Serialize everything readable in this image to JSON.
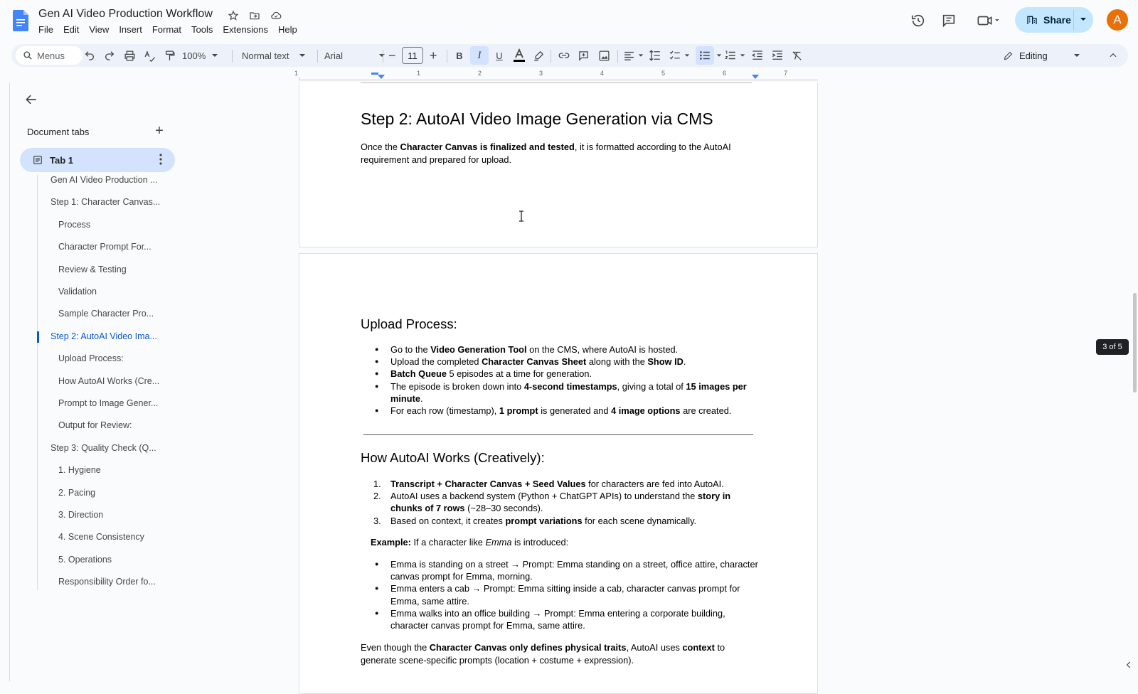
{
  "doc_title": "Gen AI Video Production Workflow",
  "menu": [
    "File",
    "Edit",
    "View",
    "Insert",
    "Format",
    "Tools",
    "Extensions",
    "Help"
  ],
  "share_label": "Share",
  "avatar_letter": "A",
  "toolbar": {
    "search_label": "Menus",
    "zoom": "100%",
    "style": "Normal text",
    "font": "Arial",
    "font_size": "11",
    "mode": "Editing"
  },
  "ruler_numbers": [
    "1",
    "1",
    "2",
    "3",
    "4",
    "5",
    "6",
    "7"
  ],
  "sidebar": {
    "title": "Document tabs",
    "tab_label": "Tab 1",
    "outline": [
      {
        "text": "Gen AI Video Production ...",
        "level": 1
      },
      {
        "text": "Step 1: Character Canvas...",
        "level": 1
      },
      {
        "text": "Process",
        "level": 2
      },
      {
        "text": "Character Prompt For...",
        "level": 2
      },
      {
        "text": "Review & Testing",
        "level": 2
      },
      {
        "text": "Validation",
        "level": 2
      },
      {
        "text": "Sample Character Pro...",
        "level": 2
      },
      {
        "text": "Step 2: AutoAI Video Ima...",
        "level": 1,
        "active": true
      },
      {
        "text": "Upload Process:",
        "level": 2
      },
      {
        "text": "How AutoAI Works (Cre...",
        "level": 2
      },
      {
        "text": "Prompt to Image Gener...",
        "level": 2
      },
      {
        "text": "Output for Review:",
        "level": 2
      },
      {
        "text": "Step 3: Quality Check (Q...",
        "level": 1
      },
      {
        "text": "1. Hygiene",
        "level": 2
      },
      {
        "text": "2. Pacing",
        "level": 2
      },
      {
        "text": "3. Direction",
        "level": 2
      },
      {
        "text": "4. Scene Consistency",
        "level": 2
      },
      {
        "text": "5. Operations",
        "level": 2
      },
      {
        "text": "Responsibility Order fo...",
        "level": 2
      }
    ]
  },
  "doc": {
    "step2_heading": "Step 2: AutoAI Video Image Generation via CMS",
    "step2_p_a": "Once the ",
    "step2_p_b": "Character Canvas is finalized and tested",
    "step2_p_c": ", it is formatted according to the AutoAI requirement and prepared for upload.",
    "upload_heading": "Upload Process:",
    "upload_items": [
      {
        "a": "Go to the ",
        "b": "Video Generation Tool",
        "c": " on the CMS, where AutoAI is hosted."
      },
      {
        "a": "Upload the completed ",
        "b": "Character Canvas Sheet",
        "c": " along with the ",
        "d": "Show ID",
        "e": "."
      },
      {
        "a": "",
        "b": "Batch Queue",
        "c": " 5 episodes at a time for generation."
      },
      {
        "a": "The episode is broken down into ",
        "b": "4-second timestamps",
        "c": ", giving a total of ",
        "d": "15 images per minute",
        "e": "."
      },
      {
        "a": "For each row (timestamp), ",
        "b": "1 prompt",
        "c": " is generated and ",
        "d": "4 image options",
        "e": " are created."
      }
    ],
    "how_heading": "How AutoAI Works (Creatively):",
    "how_items": [
      {
        "num": "1.",
        "a": "",
        "b": "Transcript + Character Canvas + Seed Values",
        "c": " for characters are fed into AutoAI.",
        "d": "",
        "e": ""
      },
      {
        "num": "2.",
        "a": "AutoAI uses a backend system (Python + ChatGPT APIs) to understand the ",
        "b": "story in chunks of 7 rows",
        "c": " (~28–30 seconds).",
        "d": "",
        "e": ""
      },
      {
        "num": "3.",
        "a": "Based on context, it creates ",
        "b": "prompt variations",
        "c": " for each scene dynamically.",
        "d": "",
        "e": ""
      }
    ],
    "example_label": "Example:",
    "example_a": " If a character like ",
    "example_name": "Emma",
    "example_b": " is introduced:",
    "example_items": [
      "Emma is standing on a street → Prompt: Emma standing on a street, office attire, character canvas prompt for Emma, morning.",
      "Emma enters a cab → Prompt: Emma sitting inside a cab, character canvas prompt for Emma, same attire.",
      "Emma walks into an office building → Prompt: Emma entering a corporate building, character canvas prompt for Emma, same attire."
    ],
    "final_a": "Even though the ",
    "final_b": "Character Canvas only defines physical traits",
    "final_c": ", AutoAI uses ",
    "final_d": "context",
    "final_e": " to generate scene-specific prompts (location + costume + expression)."
  },
  "page_badge": "3 of 5",
  "colors": {
    "accent": "#0b57d0",
    "share_bg": "#c2e7ff",
    "tab_active_bg": "#d3e3fd",
    "avatar": "#e8710a"
  }
}
